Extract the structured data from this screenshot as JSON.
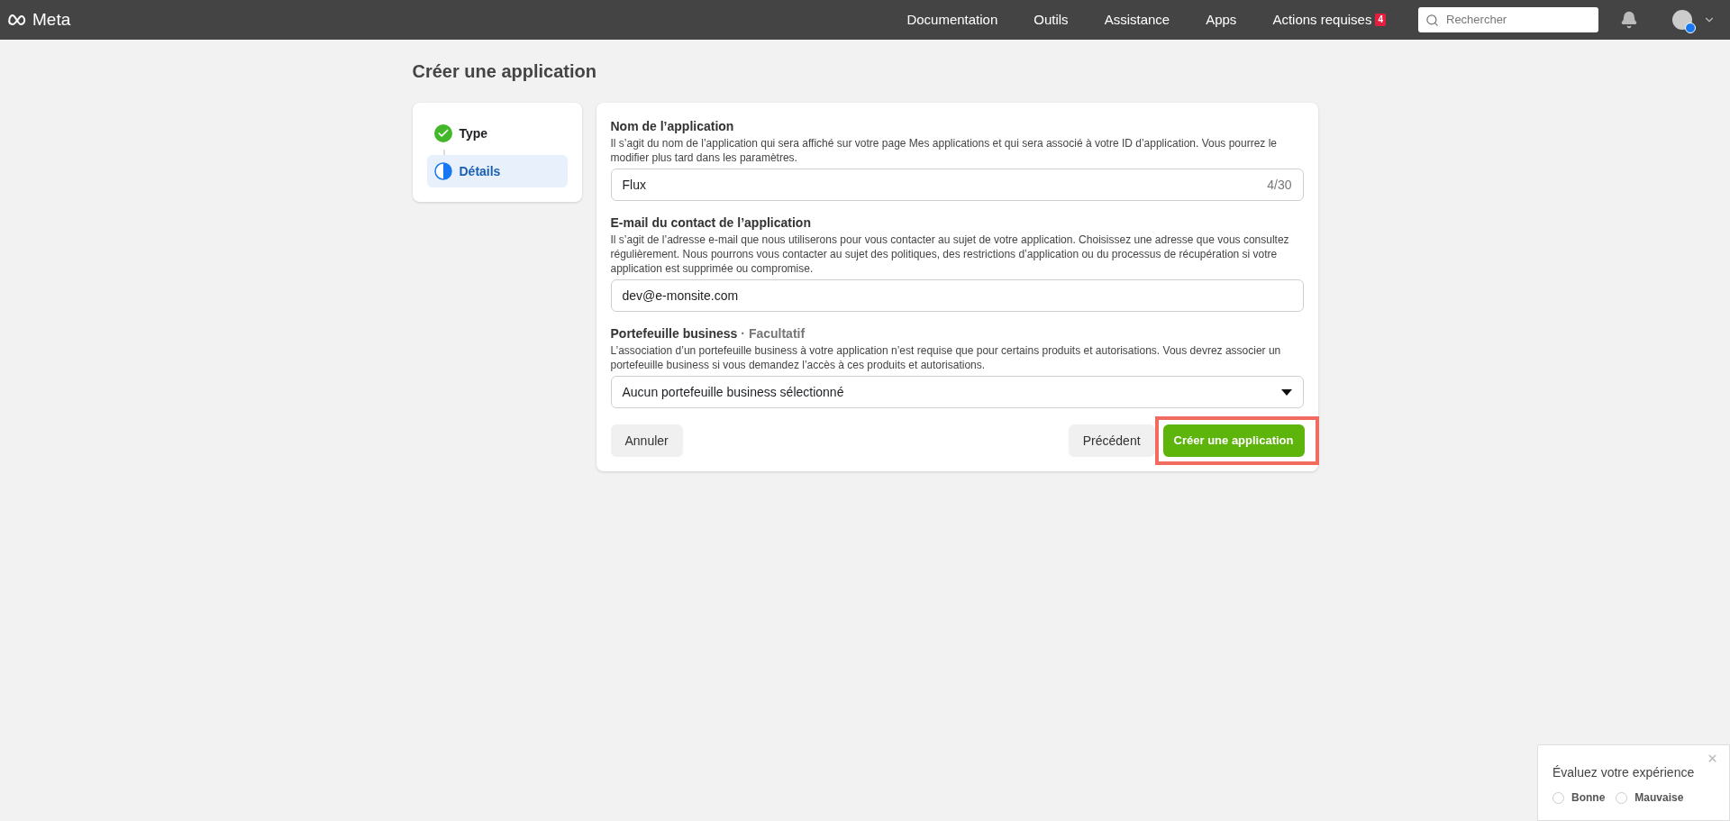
{
  "header": {
    "logo": "Meta",
    "nav": [
      {
        "label": "Documentation"
      },
      {
        "label": "Outils"
      },
      {
        "label": "Assistance"
      },
      {
        "label": "Apps"
      },
      {
        "label": "Actions requises",
        "badge": "4"
      }
    ],
    "search": {
      "placeholder": "Rechercher"
    }
  },
  "page_title": "Créer une application",
  "steps": [
    {
      "label": "Type",
      "kind": "done",
      "selected": false
    },
    {
      "label": "Détails",
      "kind": "current",
      "selected": true
    }
  ],
  "form": {
    "fields": [
      {
        "kind": "text",
        "label": "Nom de l’application",
        "help": "Il s’agit du nom de l’application qui sera affiché sur votre page Mes applications et qui sera associé à votre ID d’application. Vous pourrez le modifier plus tard dans les paramètres.",
        "value": "Flux",
        "counter": "4/30"
      },
      {
        "kind": "text",
        "label": "E-mail du contact de l’application",
        "help": "Il s’agit de l’adresse e-mail que nous utiliserons pour vous contacter au sujet de votre application. Choisissez une adresse que vous consultez régulièrement. Nous pourrons vous contacter au sujet des politiques, des restrictions d’application ou du processus de récupération si votre application est supprimée ou compromise.",
        "value": "dev@e-monsite.com"
      },
      {
        "kind": "select",
        "label": "Portefeuille business",
        "optional": "· Facultatif",
        "help": "L’association d’un portefeuille business à votre application n’est requise que pour certains produits et autorisations. Vous devrez associer un portefeuille business si vous demandez l’accès à ces produits et autorisations.",
        "value": "Aucun portefeuille business sélectionné"
      }
    ],
    "cancel": "Annuler",
    "previous": "Précédent",
    "submit": "Créer une application",
    "submit_highlighted": true
  },
  "feedback": {
    "title": "Évaluez votre expérience",
    "options": [
      {
        "label": "Bonne",
        "selected": false
      },
      {
        "label": "Mauvaise",
        "selected": false
      }
    ]
  }
}
